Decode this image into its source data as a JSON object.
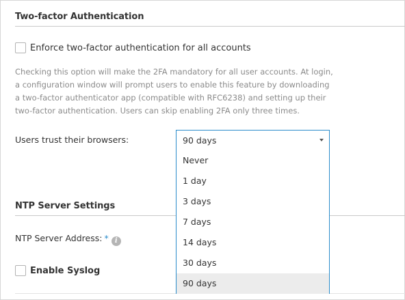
{
  "twofa": {
    "title": "Two-factor Authentication",
    "enforce_label": "Enforce two-factor authentication for all accounts",
    "enforce_checked": false,
    "help_text": "Checking this option will make the 2FA mandatory for all user accounts. At login, a configuration window will prompt users to enable this feature by downloading a two-factor authenticator app (compatible with RFC6238) and setting up their two-factor authentication. Users can skip enabling 2FA only three times.",
    "trust_label": "Users trust their browsers:",
    "trust_value": "90 days",
    "trust_options": [
      "Never",
      "1 day",
      "3 days",
      "7 days",
      "14 days",
      "30 days",
      "90 days"
    ],
    "trust_selected_index": 6
  },
  "ntp": {
    "title": "NTP Server Settings",
    "address_label": "NTP Server Address:",
    "required_mark": "*",
    "info_icon": "info-icon",
    "info_glyph": "i"
  },
  "syslog": {
    "enable_label": "Enable Syslog",
    "enable_checked": false
  },
  "colors": {
    "accent": "#2a8ccb",
    "help_text": "#8a8a8a",
    "selected_option_bg": "#ececec"
  }
}
